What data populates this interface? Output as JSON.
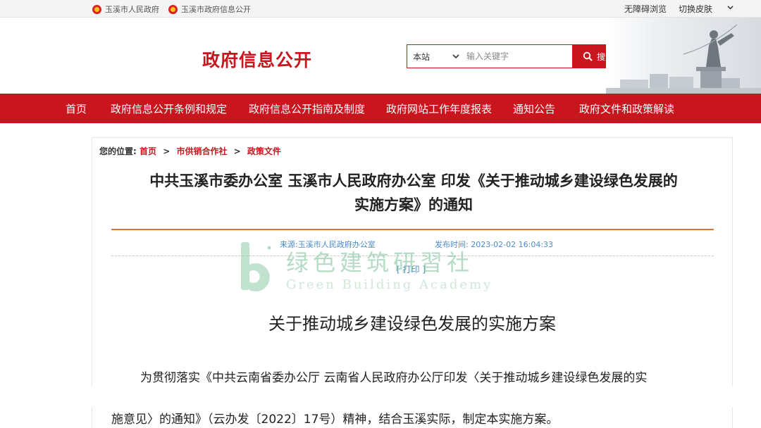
{
  "topbar": {
    "links": [
      {
        "label": "玉溪市人民政府",
        "icon": "emblem-icon"
      },
      {
        "label": "玉溪市政府信息公开",
        "icon": "emblem-icon"
      }
    ],
    "accessibility": "无障碍浏览",
    "skin": "切换皮肤"
  },
  "header": {
    "title": "政府信息公开",
    "search": {
      "scope": "本站",
      "placeholder": "输入关键字",
      "button": "搜索"
    }
  },
  "nav": {
    "items": [
      "首页",
      "政府信息公开条例和规定",
      "政府信息公开指南及制度",
      "政府网站工作年度报表",
      "通知公告",
      "政府文件和政策解读"
    ]
  },
  "breadcrumb": {
    "prefix": "您的位置:",
    "items": [
      "首页",
      "市供销合作社",
      "政策文件"
    ],
    "separator": ">"
  },
  "article": {
    "title_line1": "中共玉溪市委办公室 玉溪市人民政府办公室 印发《关于推动城乡建设绿色发展的",
    "title_line2": "实施方案》的通知",
    "source": "来源:玉溪市人民政府办公室",
    "publish_time": "发布时间: 2023-02-02 16:04:33",
    "print": "[ 打印 ]",
    "doc_title": "关于推动城乡建设绿色发展的实施方案",
    "para_line1": "为贯彻落实《中共云南省委办公厅 云南省人民政府办公厅印发〈关于推动城乡建设绿色发展的实",
    "para_line2": "施意见〉的通知》（云办发〔2022〕17号）精神，结合玉溪实际，制定本实施方案。"
  },
  "watermark": {
    "cn": "绿色建筑研習社",
    "en": "Green Building Academy"
  },
  "colors": {
    "brand_red": "#c9151e",
    "meta_blue": "#4a8bc9",
    "title_rule": "#d9773a"
  }
}
